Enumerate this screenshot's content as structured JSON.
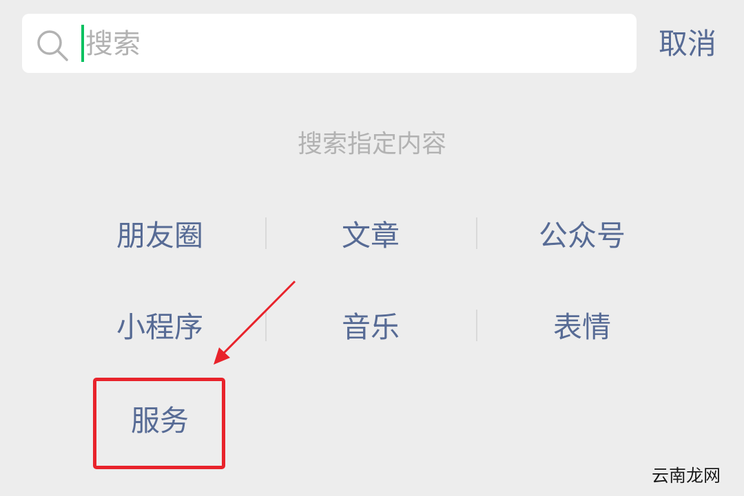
{
  "search": {
    "placeholder": "搜索",
    "value": "",
    "cancel_label": "取消"
  },
  "hint": "搜索指定内容",
  "categories": [
    {
      "label": "朋友圈"
    },
    {
      "label": "文章"
    },
    {
      "label": "公众号"
    },
    {
      "label": "小程序"
    },
    {
      "label": "音乐"
    },
    {
      "label": "表情"
    },
    {
      "label": "服务"
    }
  ],
  "annotation": {
    "highlight_color": "#e8232b",
    "highlighted_item": "服务"
  },
  "watermark": "云南龙网",
  "colors": {
    "background": "#ededed",
    "link": "#576b95",
    "hint": "#b2b2b2",
    "caret": "#07c160"
  }
}
